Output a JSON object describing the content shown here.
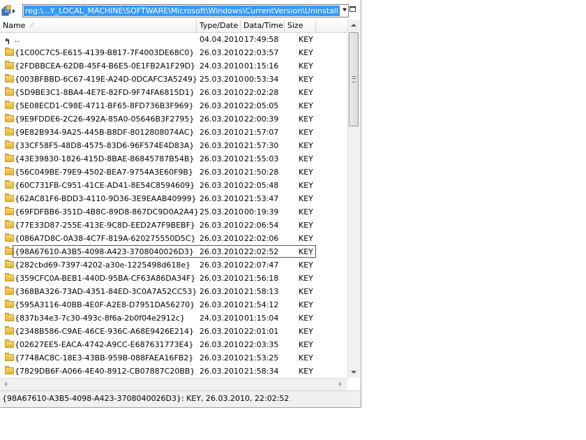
{
  "address": {
    "path": "reg:\\...Y_LOCAL_MACHINE\\SOFTWARE\\Microsoft\\Windows\\CurrentVersion\\Uninstall"
  },
  "columns": {
    "name": "Name",
    "type_date": "Type/Date",
    "data_time": "Data/Time",
    "size": "Size"
  },
  "rows": [
    {
      "name": "..",
      "date": "04.04.2010",
      "time": "17:49:58",
      "size": "KEY",
      "icon": "up-folder-icon"
    },
    {
      "name": "{1C00C7C5-E615-4139-B817-7F4003DE68C0}",
      "date": "26.03.2010",
      "time": "22:03:57",
      "size": "KEY",
      "icon": "folder-icon"
    },
    {
      "name": "{2FDBBCEA-62DB-45F4-B6E5-0E1FB2A1F29D}",
      "date": "24.03.2010",
      "time": "01:15:16",
      "size": "KEY",
      "icon": "folder-icon"
    },
    {
      "name": "{003BFBBD-6C67-419E-A24D-0DCAFC3A5249}",
      "date": "25.03.2010",
      "time": "00:53:34",
      "size": "KEY",
      "icon": "folder-icon"
    },
    {
      "name": "{5D9BE3C1-8BA4-4E7E-82FD-9F74FA6815D1}",
      "date": "26.03.2010",
      "time": "22:02:28",
      "size": "KEY",
      "icon": "folder-icon"
    },
    {
      "name": "{5E08ECD1-C98E-4711-BF65-8FD736B3F969}",
      "date": "26.03.2010",
      "time": "22:05:05",
      "size": "KEY",
      "icon": "folder-icon"
    },
    {
      "name": "{9E9FDDE6-2C26-492A-85A0-05646B3F2795}",
      "date": "26.03.2010",
      "time": "22:00:39",
      "size": "KEY",
      "icon": "folder-icon"
    },
    {
      "name": "{9E82B934-9A25-445B-B8DF-8012808074AC}",
      "date": "26.03.2010",
      "time": "21:57:07",
      "size": "KEY",
      "icon": "folder-icon"
    },
    {
      "name": "{33CF58F5-48D8-4575-83D6-96F574E4D83A}",
      "date": "26.03.2010",
      "time": "21:57:30",
      "size": "KEY",
      "icon": "folder-icon"
    },
    {
      "name": "{43E39830-1826-415D-8BAE-86845787B54B}",
      "date": "26.03.2010",
      "time": "21:55:03",
      "size": "KEY",
      "icon": "folder-icon"
    },
    {
      "name": "{56C049BE-79E9-4502-BEA7-9754A3E60F9B}",
      "date": "26.03.2010",
      "time": "21:50:28",
      "size": "KEY",
      "icon": "folder-icon"
    },
    {
      "name": "{60C731FB-C951-41CE-AD41-8E54C8594609}",
      "date": "26.03.2010",
      "time": "22:05:48",
      "size": "KEY",
      "icon": "folder-icon"
    },
    {
      "name": "{62AC81F6-BDD3-4110-9D36-3E9EAAB40999}",
      "date": "26.03.2010",
      "time": "21:53:47",
      "size": "KEY",
      "icon": "folder-icon"
    },
    {
      "name": "{69FDFBB6-351D-4B8C-89D8-867DC9D0A2A4}",
      "date": "25.03.2010",
      "time": "00:19:39",
      "size": "KEY",
      "icon": "folder-icon"
    },
    {
      "name": "{77E33D87-255E-413E-9C8D-EED2A7F9BEBF}",
      "date": "26.03.2010",
      "time": "22:06:54",
      "size": "KEY",
      "icon": "folder-icon"
    },
    {
      "name": "{086A7D8C-0A38-4C7F-819A-620275550D5C}",
      "date": "26.03.2010",
      "time": "22:02:06",
      "size": "KEY",
      "icon": "folder-icon"
    },
    {
      "name": "{98A67610-A3B5-4098-A423-3708040026D3}",
      "date": "26.03.2010",
      "time": "22:02:52",
      "size": "KEY",
      "icon": "folder-icon",
      "selected": true
    },
    {
      "name": "{282cbd69-7397-4202-a30e-1225498d618e}",
      "date": "26.03.2010",
      "time": "22:07:47",
      "size": "KEY",
      "icon": "folder-icon"
    },
    {
      "name": "{359CFC0A-BEB1-440D-95BA-CF63A86DA34F}",
      "date": "26.03.2010",
      "time": "21:56:18",
      "size": "KEY",
      "icon": "folder-icon"
    },
    {
      "name": "{368BA326-73AD-4351-84ED-3C0A7A52CC53}",
      "date": "26.03.2010",
      "time": "21:58:13",
      "size": "KEY",
      "icon": "folder-icon"
    },
    {
      "name": "{595A3116-40BB-4E0F-A2E8-D7951DA56270}",
      "date": "26.03.2010",
      "time": "21:54:12",
      "size": "KEY",
      "icon": "folder-icon"
    },
    {
      "name": "{837b34e3-7c30-493c-8f6a-2b0f04e2912c}",
      "date": "24.03.2010",
      "time": "01:15:04",
      "size": "KEY",
      "icon": "folder-icon"
    },
    {
      "name": "{2348B586-C9AE-46CE-936C-A68E9426E214}",
      "date": "26.03.2010",
      "time": "22:01:01",
      "size": "KEY",
      "icon": "folder-icon"
    },
    {
      "name": "{02627EE5-EACA-4742-A9CC-E687631773E4}",
      "date": "26.03.2010",
      "time": "22:03:35",
      "size": "KEY",
      "icon": "folder-icon"
    },
    {
      "name": "{7748AC8C-18E3-43BB-959B-088FAEA16FB2}",
      "date": "26.03.2010",
      "time": "21:53:25",
      "size": "KEY",
      "icon": "folder-icon"
    },
    {
      "name": "{7829DB6F-A066-4E40-8912-CB07887C20BB}",
      "date": "26.03.2010",
      "time": "21:58:34",
      "size": "KEY",
      "icon": "folder-icon"
    }
  ],
  "status": {
    "text": "{98A67610-A3B5-4098-A423-3708040026D3}: KEY, 26.03.2010, 22:02:52"
  }
}
